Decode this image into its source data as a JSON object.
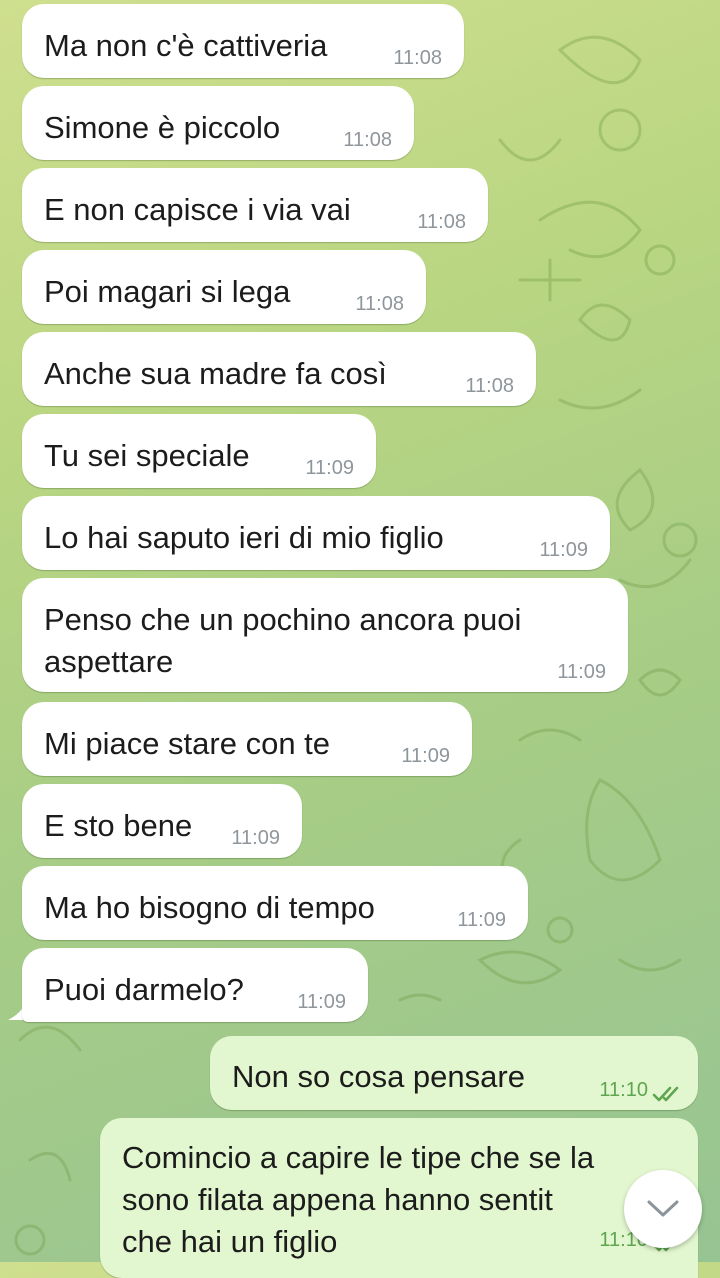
{
  "messages": [
    {
      "text": "Ma non c'è cattiveria",
      "time": "11:08",
      "direction": "incoming"
    },
    {
      "text": "Simone è piccolo",
      "time": "11:08",
      "direction": "incoming"
    },
    {
      "text": "E non capisce i via vai",
      "time": "11:08",
      "direction": "incoming"
    },
    {
      "text": "Poi magari si lega",
      "time": "11:08",
      "direction": "incoming"
    },
    {
      "text": "Anche sua madre fa così",
      "time": "11:08",
      "direction": "incoming"
    },
    {
      "text": "Tu sei speciale",
      "time": "11:09",
      "direction": "incoming"
    },
    {
      "text": "Lo hai saputo ieri di mio figlio",
      "time": "11:09",
      "direction": "incoming"
    },
    {
      "text_lines": [
        "Penso che un pochino ancora puoi",
        "aspettare"
      ],
      "time": "11:09",
      "direction": "incoming"
    },
    {
      "text": "Mi piace stare con te",
      "time": "11:09",
      "direction": "incoming"
    },
    {
      "text": "E sto bene",
      "time": "11:09",
      "direction": "incoming"
    },
    {
      "text": "Ma ho bisogno di tempo",
      "time": "11:09",
      "direction": "incoming"
    },
    {
      "text": "Puoi darmelo?",
      "time": "11:09",
      "direction": "incoming"
    },
    {
      "text": "Non so cosa pensare",
      "time": "11:10",
      "direction": "outgoing",
      "status": "read"
    },
    {
      "text_lines": [
        "Comincio a capire le tipe che se la",
        "sono filata appena hanno sentit",
        "che hai un figlio"
      ],
      "time": "11:10",
      "direction": "outgoing",
      "status": "read"
    }
  ],
  "colors": {
    "incoming_bubble": "#ffffff",
    "outgoing_bubble": "#e2f7cf",
    "read_check": "#5fa54f",
    "wallpaper": "#b9d682"
  },
  "icons": {
    "read_status": "double-check-icon",
    "scroll_down": "chevron-down-icon"
  }
}
